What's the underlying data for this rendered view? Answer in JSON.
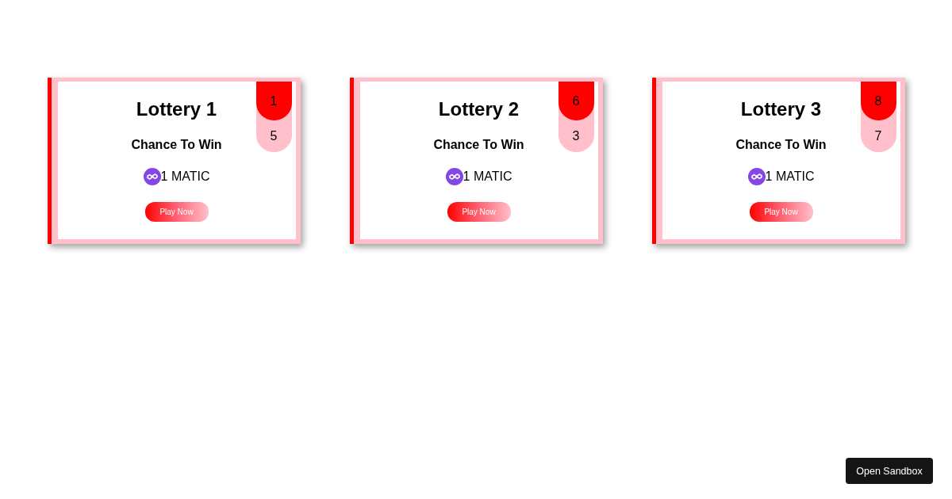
{
  "lotteries": [
    {
      "title": "Lottery 1",
      "subtitle": "Chance To Win",
      "prize": "1 MATIC",
      "button": "Play Now",
      "tags": [
        {
          "text": "1",
          "color": "#ff0000"
        },
        {
          "text": "5",
          "color": "#ffc0cb"
        }
      ]
    },
    {
      "title": "Lottery 2",
      "subtitle": "Chance To Win",
      "prize": "1 MATIC",
      "button": "Play Now",
      "tags": [
        {
          "text": "6",
          "color": "#ff0000"
        },
        {
          "text": "3",
          "color": "#ffc0cb"
        }
      ]
    },
    {
      "title": "Lottery 3",
      "subtitle": "Chance To Win",
      "prize": "1 MATIC",
      "button": "Play Now",
      "tags": [
        {
          "text": "8",
          "color": "#ff0000"
        },
        {
          "text": "7",
          "color": "#ffc0cb"
        }
      ]
    }
  ],
  "sandbox_button": "Open Sandbox"
}
